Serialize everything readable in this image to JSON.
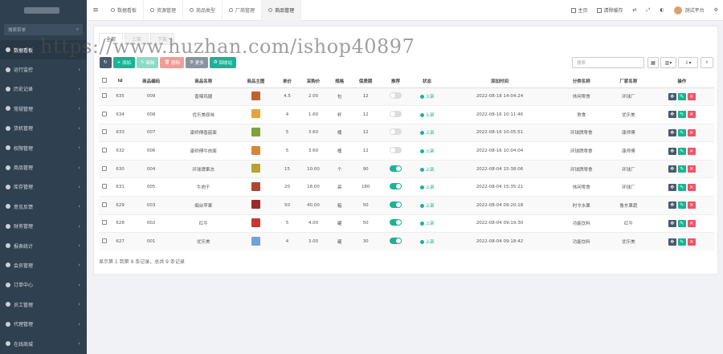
{
  "search_label": "搜索菜单",
  "sidebar": {
    "items": [
      {
        "label": "数据看板"
      },
      {
        "label": "运行监控"
      },
      {
        "label": "历史记录"
      },
      {
        "label": "常规管理"
      },
      {
        "label": "货机管理"
      },
      {
        "label": "权限管理"
      },
      {
        "label": "商品管理"
      },
      {
        "label": "库存管理"
      },
      {
        "label": "意见反馈"
      },
      {
        "label": "财务管理"
      },
      {
        "label": "报表统计"
      },
      {
        "label": "会员管理"
      },
      {
        "label": "订单中心"
      },
      {
        "label": "员工管理"
      },
      {
        "label": "代理管理"
      },
      {
        "label": "在线商城"
      }
    ]
  },
  "topbar": {
    "tabs": [
      "数据看板",
      "资源管理",
      "商品类型",
      "厂商管理",
      "商品管理"
    ],
    "home": "主页",
    "clear_cache": "清除缓存",
    "platform": "测试平台"
  },
  "subtabs": [
    "全部",
    "上架",
    "下架"
  ],
  "toolbar": {
    "add": "添加",
    "edit": "编辑",
    "delete": "删除",
    "more": "更多",
    "recycle": "回收站",
    "search_placeholder": "搜索"
  },
  "table": {
    "headers": [
      "Id",
      "商品编码",
      "商品名称",
      "商品主图",
      "单价",
      "采购价",
      "规格",
      "保质期",
      "推荐",
      "状态",
      "添加时间",
      "分类名称",
      "厂家名称",
      "操作"
    ],
    "rows": [
      {
        "id": "635",
        "code": "009",
        "name": "香辣鸡腿",
        "img": "#c0622f",
        "price": "4.5",
        "cost": "2.00",
        "unit": "包",
        "shelf": "12",
        "rec": false,
        "status": "上架",
        "time": "2022-08-18 14:04:24",
        "cat": "休闲零食",
        "vendor": "环球厂"
      },
      {
        "id": "634",
        "code": "008",
        "name": "优乐美原味",
        "img": "#e8a23a",
        "price": "4",
        "cost": "1.60",
        "unit": "杯",
        "shelf": "12",
        "rec": false,
        "status": "上架",
        "time": "2022-08-16 10:11:46",
        "cat": "熟食",
        "vendor": "优乐美"
      },
      {
        "id": "633",
        "code": "007",
        "name": "康师傅香菇面",
        "img": "#7fa33c",
        "price": "5",
        "cost": "3.60",
        "unit": "桶",
        "shelf": "12",
        "rec": false,
        "status": "上架",
        "time": "2022-08-16 10:05:51",
        "cat": "环球牌零食",
        "vendor": "康师傅"
      },
      {
        "id": "632",
        "code": "006",
        "name": "康师傅牛肉面",
        "img": "#d4873a",
        "price": "5",
        "cost": "3.60",
        "unit": "桶",
        "shelf": "12",
        "rec": false,
        "status": "上架",
        "time": "2022-08-16 10:04:04",
        "cat": "环球牌零食",
        "vendor": "康师傅"
      },
      {
        "id": "630",
        "code": "004",
        "name": "环球牌果冻",
        "img": "#b8a42c",
        "price": "15",
        "cost": "10.00",
        "unit": "个",
        "shelf": "90",
        "rec": true,
        "status": "上架",
        "time": "2022-08-04 15:38:06",
        "cat": "环球牌零食",
        "vendor": "环球厂"
      },
      {
        "id": "631",
        "code": "005",
        "name": "牛肉干",
        "img": "#a84a2e",
        "price": "20",
        "cost": "16.00",
        "unit": "袋",
        "shelf": "180",
        "rec": true,
        "status": "上架",
        "time": "2022-08-04 15:35:21",
        "cat": "休闲零食",
        "vendor": "环球厂"
      },
      {
        "id": "629",
        "code": "003",
        "name": "烟台苹果",
        "img": "#9b2a2a",
        "price": "50",
        "cost": "40.00",
        "unit": "箱",
        "shelf": "50",
        "rec": true,
        "status": "上架",
        "time": "2022-08-04 09:20:18",
        "cat": "时令水果",
        "vendor": "鲁东果蔬"
      },
      {
        "id": "628",
        "code": "002",
        "name": "红牛",
        "img": "#c23b2e",
        "price": "5",
        "cost": "4.00",
        "unit": "罐",
        "shelf": "50",
        "rec": true,
        "status": "上架",
        "time": "2022-08-04 09:19:30",
        "cat": "功能饮料",
        "vendor": "红牛"
      },
      {
        "id": "627",
        "code": "001",
        "name": "优乐美",
        "img": "#6fa3d8",
        "price": "4",
        "cost": "3.00",
        "unit": "罐",
        "shelf": "30",
        "rec": true,
        "status": "上架",
        "time": "2022-08-04 09:18:42",
        "cat": "功能饮料",
        "vendor": "优乐美"
      }
    ]
  },
  "pager": "显示第 1 到第 9 条记录，总共 9 条记录",
  "watermark": "https://www.huzhan.com/ishop40897"
}
